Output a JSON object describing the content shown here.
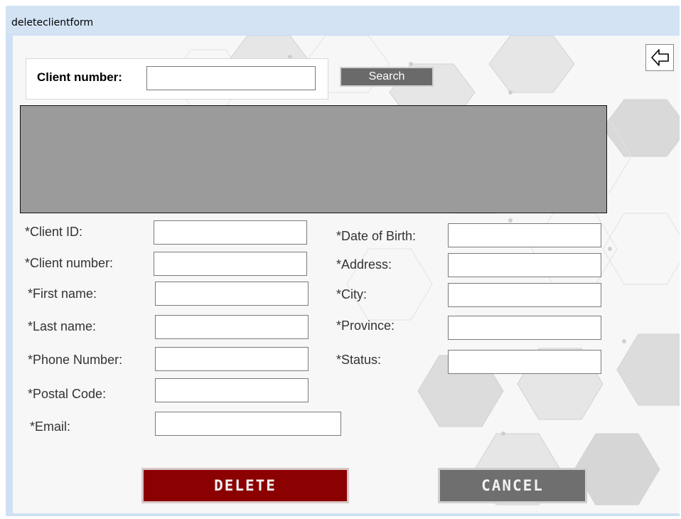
{
  "window": {
    "title": "deleteclientform"
  },
  "search": {
    "label": "Client number:",
    "value": "",
    "button_label": "Search"
  },
  "fields_left": [
    {
      "label": "*Client ID:",
      "value": ""
    },
    {
      "label": "*Client number:",
      "value": ""
    },
    {
      "label": "*First name:",
      "value": ""
    },
    {
      "label": "*Last name:",
      "value": ""
    },
    {
      "label": "*Phone Number:",
      "value": ""
    },
    {
      "label": "*Postal Code:",
      "value": ""
    },
    {
      "label": "*Email:",
      "value": ""
    }
  ],
  "fields_right": [
    {
      "label": "*Date of Birth:",
      "value": ""
    },
    {
      "label": "*Address:",
      "value": ""
    },
    {
      "label": "*City:",
      "value": ""
    },
    {
      "label": "*Province:",
      "value": ""
    },
    {
      "label": "*Status:",
      "value": ""
    }
  ],
  "actions": {
    "delete_label": "DELETE",
    "cancel_label": "CANCEL"
  },
  "icons": {
    "back": "back-arrow-icon"
  },
  "colors": {
    "delete": "#8b0000",
    "cancel": "#6f6f6f",
    "search": "#6a6a6a",
    "grid": "#9b9b9b",
    "titlebar": "#d3e3f4"
  }
}
